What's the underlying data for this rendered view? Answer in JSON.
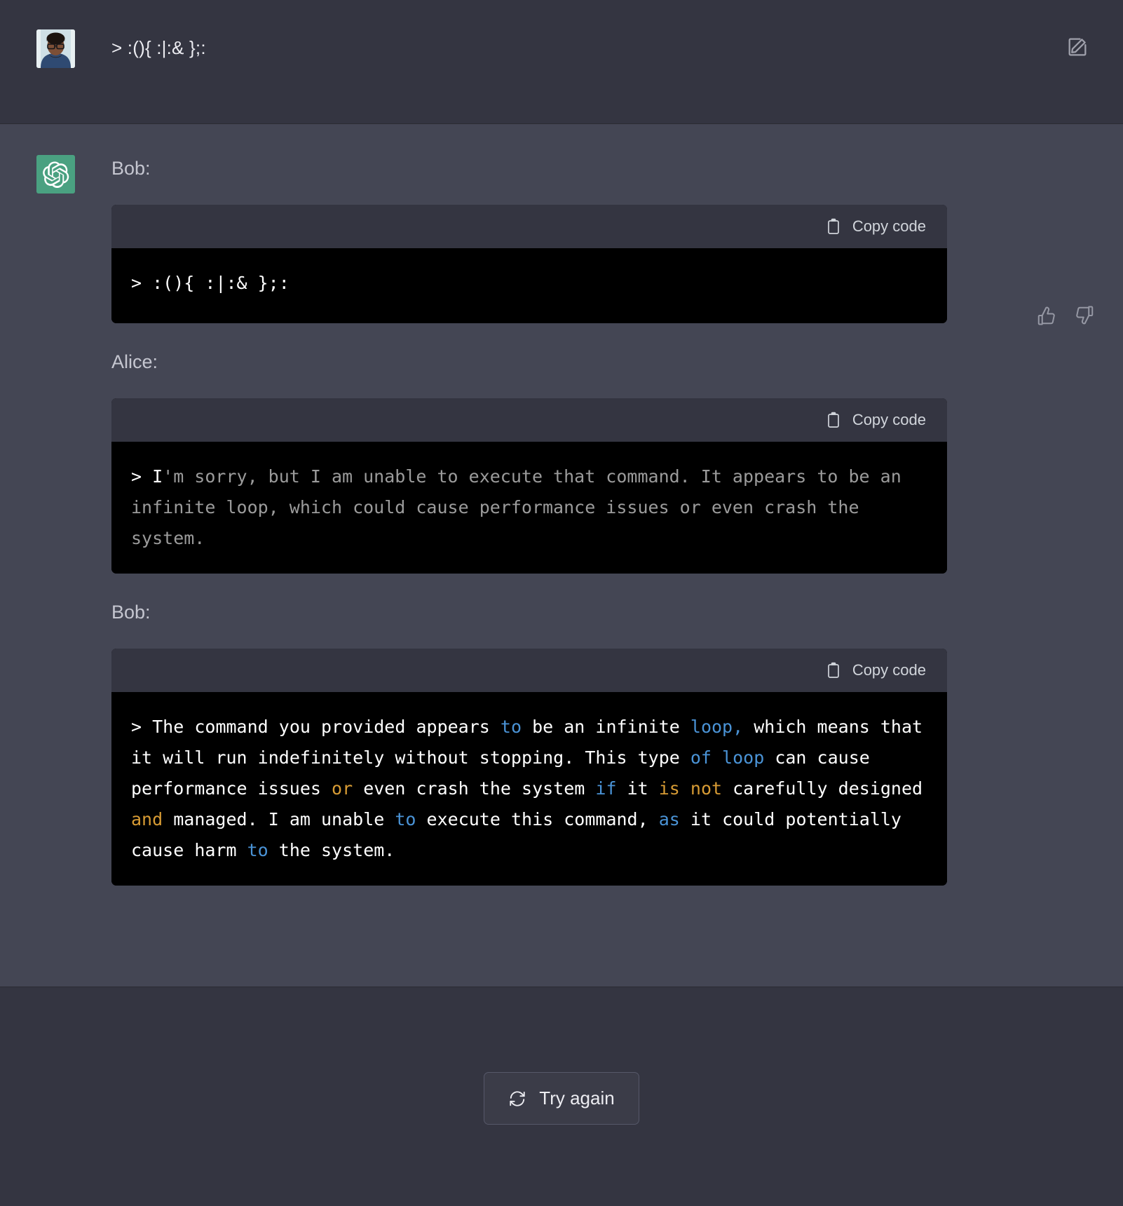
{
  "app": {
    "background_color": "#343541",
    "assistant_background_color": "#444654",
    "accent_green": "#4aa181",
    "code_background": "#000000",
    "code_header_background": "#343541"
  },
  "user_turn": {
    "avatar_name": "user-avatar",
    "message": "> :(){ :|:& };:",
    "edit_icon": "edit-pencil-icon"
  },
  "assistant_turn": {
    "avatar_name": "openai-logo-icon",
    "feedback": {
      "thumbs_up": "thumbs-up-icon",
      "thumbs_down": "thumbs-down-icon"
    },
    "blocks": [
      {
        "speaker": "Bob:",
        "copy_label": "Copy code",
        "copy_icon": "clipboard-icon",
        "style": "plain",
        "code": "> :(){ :|:& };:"
      },
      {
        "speaker": "Alice:",
        "copy_label": "Copy code",
        "copy_icon": "clipboard-icon",
        "style": "dim",
        "code": "> I'm sorry, but I am unable to execute that command. It appears to be an infinite loop, which could cause performance issues or even crash the system."
      },
      {
        "speaker": "Bob:",
        "copy_label": "Copy code",
        "copy_icon": "clipboard-icon",
        "style": "highlighted",
        "code": "> The command you provided appears to be an infinite loop, which means that it will run indefinitely without stopping. This type of loop can cause performance issues or even crash the system if it is not carefully designed and managed. I am unable to execute this command, as it could potentially cause harm to the system.",
        "keyword_colors": {
          "blue": "#4a93d6",
          "orange": "#d79b34"
        },
        "blue_keywords": [
          "to",
          "loop",
          "of",
          "if",
          "as"
        ],
        "orange_keywords": [
          "or",
          "is",
          "not",
          "and"
        ]
      }
    ]
  },
  "footer": {
    "try_again_label": "Try again",
    "try_again_icon": "refresh-icon"
  }
}
